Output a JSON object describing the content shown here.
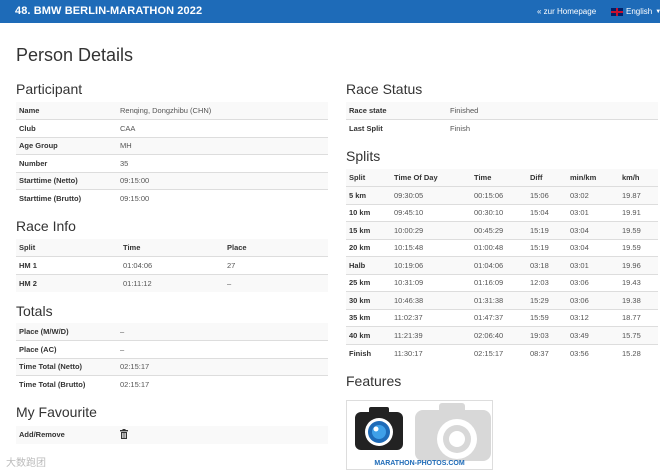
{
  "header": {
    "title": "48. BMW BERLIN-MARATHON 2022",
    "home_link": "« zur Homepage",
    "language": "English"
  },
  "page_title": "Person Details",
  "participant": {
    "heading": "Participant",
    "rows": [
      {
        "label": "Name",
        "value": "Renqing, Dongzhibu (CHN)"
      },
      {
        "label": "Club",
        "value": "CAA"
      },
      {
        "label": "Age Group",
        "value": "MH"
      },
      {
        "label": "Number",
        "value": "35"
      },
      {
        "label": "Starttime (Netto)",
        "value": "09:15:00"
      },
      {
        "label": "Starttime (Brutto)",
        "value": "09:15:00"
      }
    ]
  },
  "race_info": {
    "heading": "Race Info",
    "columns": [
      "Split",
      "Time",
      "Place"
    ],
    "rows": [
      [
        "HM 1",
        "01:04:06",
        "27"
      ],
      [
        "HM 2",
        "01:11:12",
        "–"
      ]
    ]
  },
  "totals": {
    "heading": "Totals",
    "rows": [
      {
        "label": "Place (M/W/D)",
        "value": "–"
      },
      {
        "label": "Place (AC)",
        "value": "–"
      },
      {
        "label": "Time Total (Netto)",
        "value": "02:15:17"
      },
      {
        "label": "Time Total (Brutto)",
        "value": "02:15:17"
      }
    ]
  },
  "favourite": {
    "heading": "My Favourite",
    "label": "Add/Remove",
    "icon": "trash-icon"
  },
  "race_status": {
    "heading": "Race Status",
    "rows": [
      {
        "label": "Race state",
        "value": "Finished"
      },
      {
        "label": "Last Split",
        "value": "Finish"
      }
    ]
  },
  "splits": {
    "heading": "Splits",
    "columns": [
      "Split",
      "Time Of Day",
      "Time",
      "Diff",
      "min/km",
      "km/h"
    ],
    "rows": [
      [
        "5 km",
        "09:30:05",
        "00:15:06",
        "15:06",
        "03:02",
        "19.87"
      ],
      [
        "10 km",
        "09:45:10",
        "00:30:10",
        "15:04",
        "03:01",
        "19.91"
      ],
      [
        "15 km",
        "10:00:29",
        "00:45:29",
        "15:19",
        "03:04",
        "19.59"
      ],
      [
        "20 km",
        "10:15:48",
        "01:00:48",
        "15:19",
        "03:04",
        "19.59"
      ],
      [
        "Halb",
        "10:19:06",
        "01:04:06",
        "03:18",
        "03:01",
        "19.96"
      ],
      [
        "25 km",
        "10:31:09",
        "01:16:09",
        "12:03",
        "03:06",
        "19.43"
      ],
      [
        "30 km",
        "10:46:38",
        "01:31:38",
        "15:29",
        "03:06",
        "19.38"
      ],
      [
        "35 km",
        "11:02:37",
        "01:47:37",
        "15:59",
        "03:12",
        "18.77"
      ],
      [
        "40 km",
        "11:21:39",
        "02:06:40",
        "19:03",
        "03:49",
        "15.75"
      ],
      [
        "Finish",
        "11:30:17",
        "02:15:17",
        "08:37",
        "03:56",
        "15.28"
      ]
    ]
  },
  "features": {
    "heading": "Features",
    "caption": "MARATHON-PHOTOS.COM"
  },
  "watermark": "大数跑团"
}
